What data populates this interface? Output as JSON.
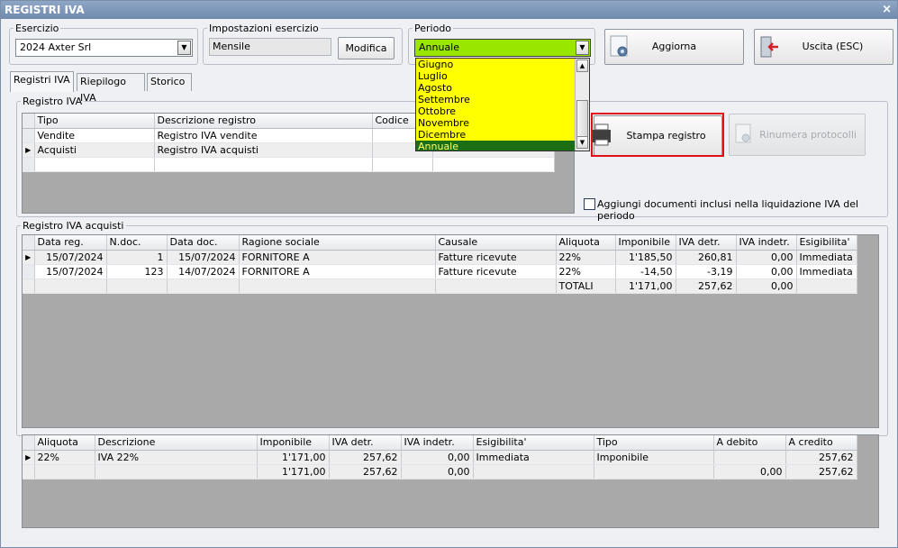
{
  "window": {
    "title": "REGISTRI IVA",
    "close_glyph": "×"
  },
  "esercizio": {
    "label": "Esercizio",
    "value": "2024 Axter Srl"
  },
  "impostazioni": {
    "label": "Impostazioni esercizio",
    "value": "Mensile",
    "modifica_label": "Modifica"
  },
  "periodo": {
    "label": "Periodo",
    "value": "Annuale",
    "options": [
      "Giugno",
      "Luglio",
      "Agosto",
      "Settembre",
      "Ottobre",
      "Novembre",
      "Dicembre",
      "Annuale"
    ],
    "selected_index": 7
  },
  "toolbar": {
    "aggiorna_label": "Aggiorna",
    "uscita_label": "Uscita (ESC)"
  },
  "tabs": [
    "Registri IVA",
    "Riepilogo IVA",
    "Storico"
  ],
  "registro_iva": {
    "label": "Registro IVA",
    "columns": [
      "Tipo",
      "Descrizione registro",
      "Codice"
    ],
    "rows": [
      {
        "tipo": "Vendite",
        "descrizione": "Registro IVA vendite",
        "codice": ""
      },
      {
        "tipo": "Acquisti",
        "descrizione": "Registro IVA acquisti",
        "codice": ""
      }
    ]
  },
  "actions": {
    "stampa_label": "Stampa registro",
    "rinumera_label": "Rinumera protocolli"
  },
  "checkbox_label": "Aggiungi documenti inclusi nella liquidazione IVA del periodo",
  "acquisti": {
    "label": "Registro IVA acquisti",
    "columns": [
      "Data reg.",
      "N.doc.",
      "Data doc.",
      "Ragione sociale",
      "Causale",
      "Aliquota",
      "Imponibile",
      "IVA detr.",
      "IVA indetr.",
      "Esigibilita'"
    ],
    "rows": [
      [
        "15/07/2024",
        "1",
        "15/07/2024",
        "FORNITORE A",
        "Fatture ricevute",
        "22%",
        "1'185,50",
        "260,81",
        "0,00",
        "Immediata"
      ],
      [
        "15/07/2024",
        "123",
        "14/07/2024",
        "FORNITORE A",
        "Fatture ricevute",
        "22%",
        "-14,50",
        "-3,19",
        "0,00",
        "Immediata"
      ]
    ],
    "totals": {
      "label": "TOTALI",
      "imponibile": "1'171,00",
      "iva_detr": "257,62",
      "iva_indetr": "0,00"
    }
  },
  "riepilogo": {
    "columns": [
      "Aliquota",
      "Descrizione",
      "Imponibile",
      "IVA detr.",
      "IVA indetr.",
      "Esigibilita'",
      "Tipo",
      "A debito",
      "A credito"
    ],
    "rows": [
      [
        "22%",
        "IVA 22%",
        "1'171,00",
        "257,62",
        "0,00",
        "Immediata",
        "Imponibile",
        "",
        "257,62"
      ],
      [
        "",
        "",
        "1'171,00",
        "257,62",
        "0,00",
        "",
        "",
        "0,00",
        "257,62"
      ]
    ]
  },
  "colors": {
    "dropdown_bg": "#ffff00",
    "combo_active_bg": "#99e600",
    "selected_option_bg": "#1b6e13",
    "highlight_frame": "#e0101a"
  },
  "icons": [
    "close-icon",
    "chevron-down-icon",
    "gear-icon",
    "exit-door-icon",
    "printer-icon",
    "row-indicator-icon"
  ]
}
